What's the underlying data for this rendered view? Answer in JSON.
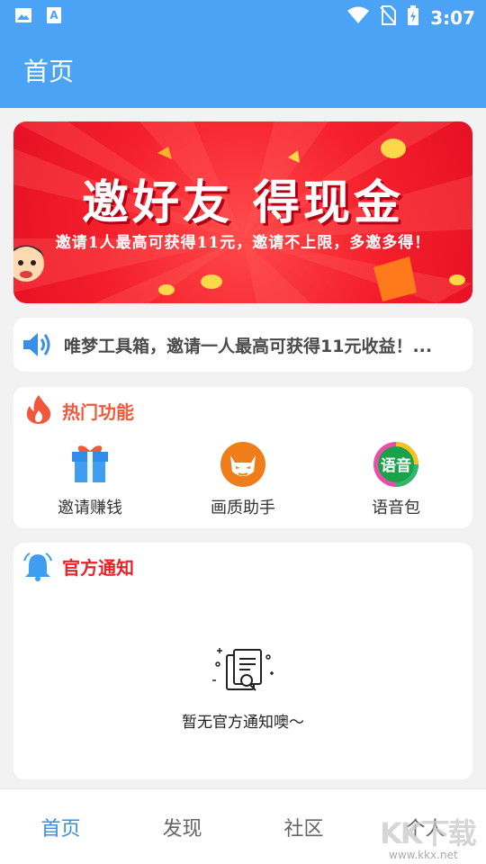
{
  "status_bar": {
    "time": "3:07",
    "icons": [
      "image-icon",
      "font-icon",
      "wifi-icon",
      "no-sim-icon",
      "battery-charging-icon"
    ]
  },
  "app_bar": {
    "title": "首页"
  },
  "banner": {
    "title": "邀好友 得现金",
    "subtitle": "邀请1人最高可获得11元，邀请不上限，多邀多得！"
  },
  "notice": {
    "icon": "speaker-icon",
    "text": "唯梦工具箱，邀请一人最高可获得11元收益！..."
  },
  "hot_features": {
    "title": "热门功能",
    "icon": "flame-icon",
    "items": [
      {
        "label": "邀请赚钱",
        "icon": "gift-icon"
      },
      {
        "label": "画质助手",
        "icon": "devil-face-icon"
      },
      {
        "label": "语音包",
        "icon": "voice-pack-icon",
        "badge_text": "语音"
      }
    ]
  },
  "official_notice": {
    "title": "官方通知",
    "icon": "bell-icon",
    "empty_text": "暂无官方通知噢～"
  },
  "bottom_nav": {
    "items": [
      {
        "label": "首页",
        "active": true
      },
      {
        "label": "发现",
        "active": false
      },
      {
        "label": "社区",
        "active": false
      },
      {
        "label": "个人",
        "active": false
      }
    ],
    "watermark": "KK下载",
    "watermark_url": "www.kkx.net"
  },
  "colors": {
    "primary": "#4aa3f5",
    "banner_red": "#f41f2c",
    "hot_title": "#f05a3c",
    "official_title": "#e8232a",
    "nav_active": "#3a8ee6"
  }
}
